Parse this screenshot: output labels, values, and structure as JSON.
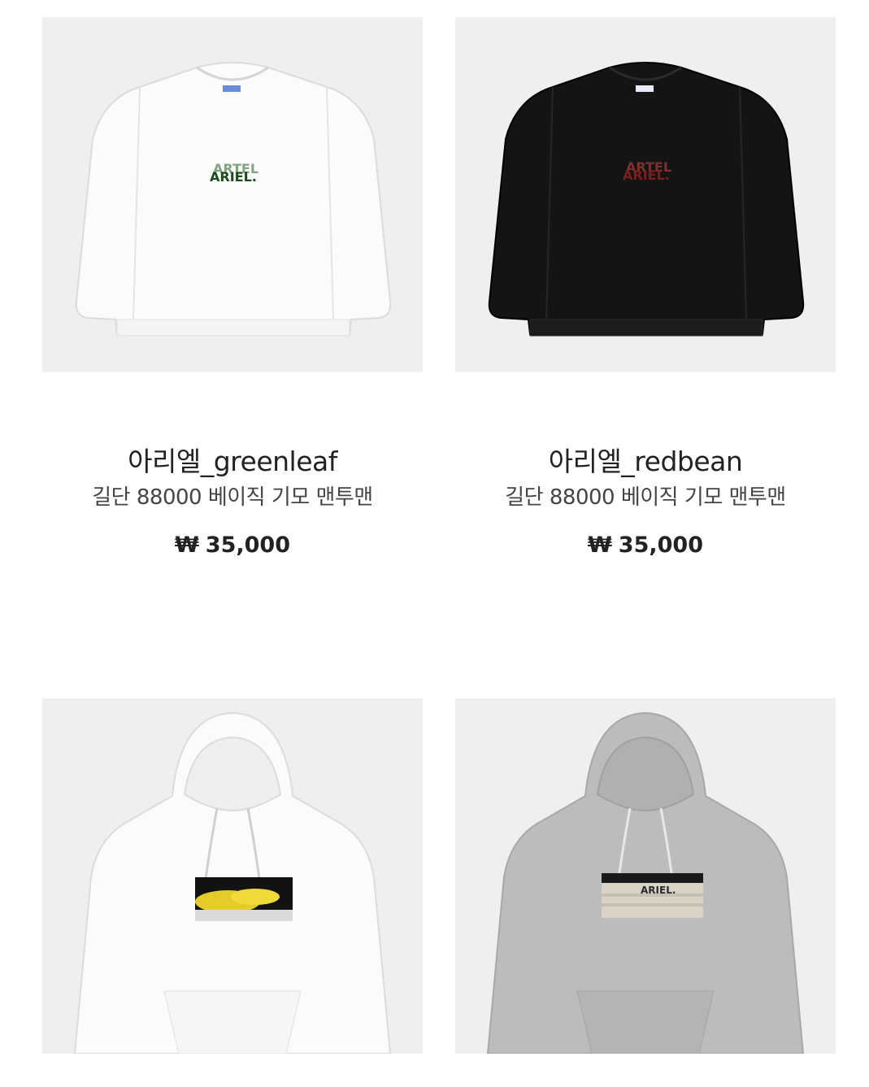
{
  "products": [
    {
      "name": "아리엘_greenleaf",
      "description": "길단 88000 베이직 기모 맨투맨",
      "currency": "₩",
      "price": "35,000",
      "garment_color": "#fafafa",
      "print_color": "#2f6b2c",
      "type": "sweatshirt"
    },
    {
      "name": "아리엘_redbean",
      "description": "길단 88000 베이직 기모 맨투맨",
      "currency": "₩",
      "price": "35,000",
      "garment_color": "#111111",
      "print_color": "#9a2a2a",
      "type": "sweatshirt"
    },
    {
      "type": "hoodie",
      "garment_color": "#fafafa",
      "print_color": "#e6cc2a"
    },
    {
      "type": "hoodie",
      "garment_color": "#b9b9b9",
      "print_color": "#d9d4c8"
    }
  ],
  "print_text": "ARIEL."
}
